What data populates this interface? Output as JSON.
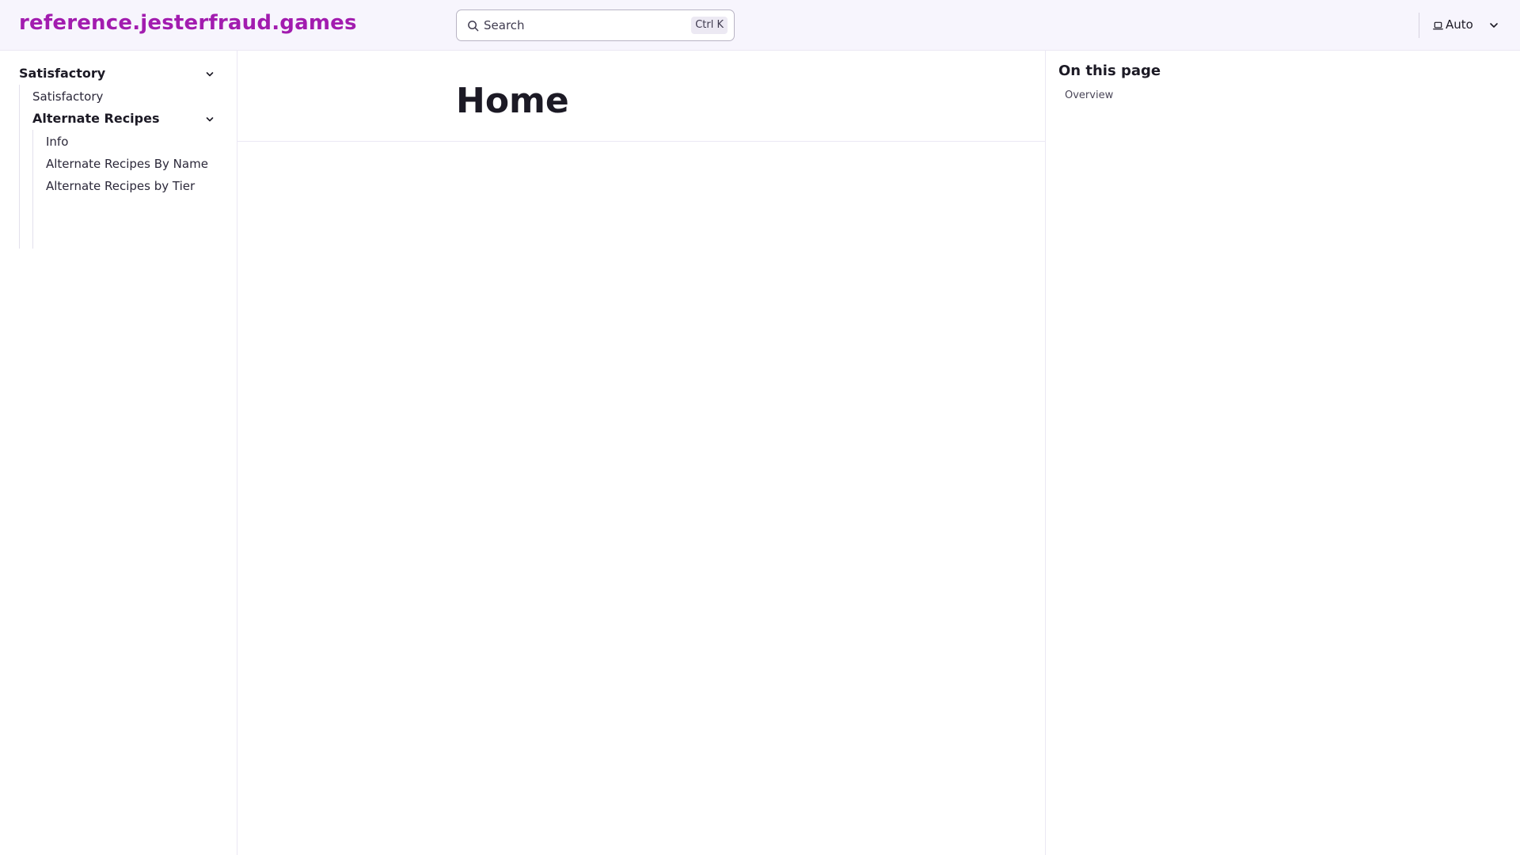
{
  "header": {
    "site_title": "reference.jesterfraud.games",
    "search": {
      "placeholder": "Search",
      "shortcut": "Ctrl K"
    },
    "theme": {
      "label": "Auto",
      "icon": "laptop-icon"
    }
  },
  "sidebar": {
    "group": {
      "label": "Satisfactory",
      "expanded": true,
      "items": [
        {
          "label": "Satisfactory"
        }
      ],
      "subgroup": {
        "label": "Alternate Recipes",
        "expanded": true,
        "items": [
          {
            "label": "Info"
          },
          {
            "label": "Alternate Recipes By Name"
          },
          {
            "label": "Alternate Recipes by Tier"
          }
        ]
      }
    }
  },
  "main": {
    "title": "Home"
  },
  "toc": {
    "title": "On this page",
    "items": [
      {
        "label": "Overview"
      }
    ]
  },
  "colors": {
    "brand": "#a21caf",
    "header_bg": "#f7f5fd",
    "text": "#1c1a25",
    "border": "#ebe8f4"
  }
}
